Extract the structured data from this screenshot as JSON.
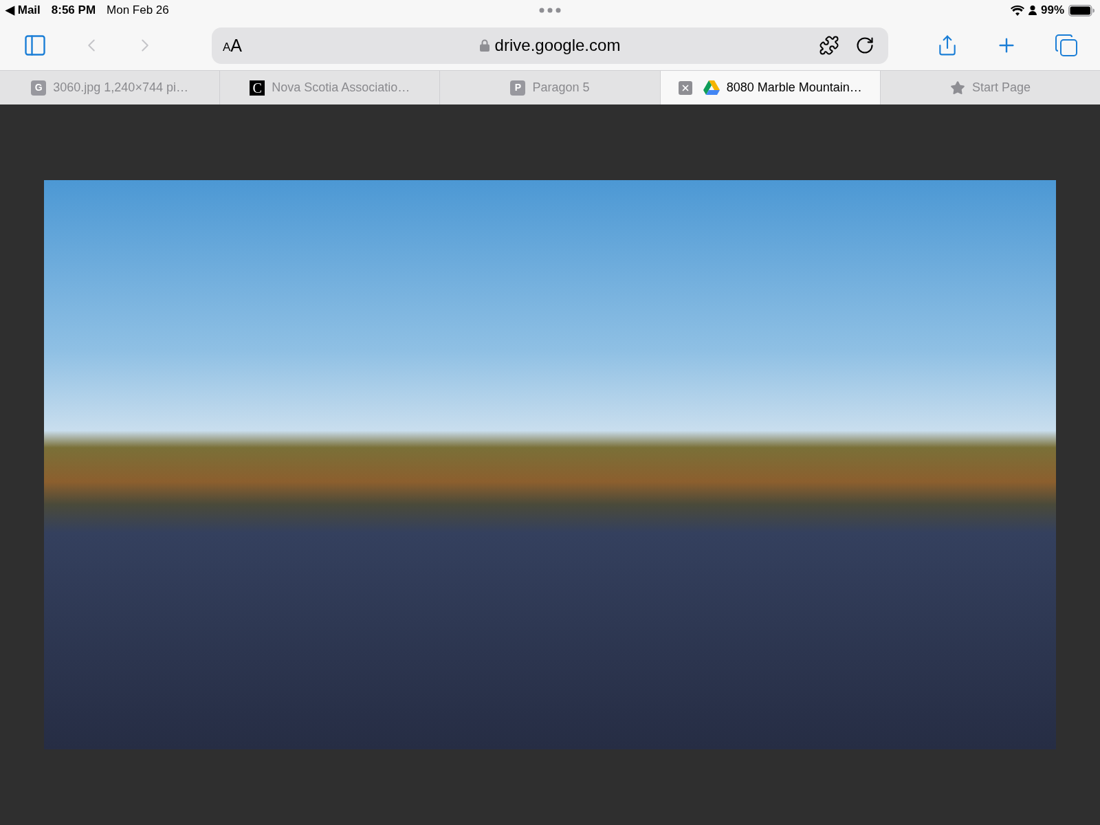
{
  "status_bar": {
    "back_link": "◀ Mail",
    "time": "8:56 PM",
    "date": "Mon Feb 26",
    "battery_percent": "99%"
  },
  "toolbar": {
    "back_button": {
      "disabled": true
    },
    "forward_button": {
      "disabled": true
    },
    "address_bar": {
      "text_size_button": [
        "A",
        "A"
      ],
      "url": "drive.google.com"
    }
  },
  "tabs": [
    {
      "kind": "letter",
      "favicon": "G",
      "title": "3060.jpg 1,240×744 pi…",
      "selected": false
    },
    {
      "kind": "dark-letter",
      "favicon": "C",
      "title": "Nova Scotia Associatio…",
      "selected": false
    },
    {
      "kind": "letter",
      "favicon": "P",
      "title": "Paragon 5",
      "selected": false
    },
    {
      "kind": "drive",
      "title": "8080 Marble Mountain…",
      "selected": true
    },
    {
      "kind": "star",
      "title": "Start Page",
      "selected": false
    }
  ]
}
